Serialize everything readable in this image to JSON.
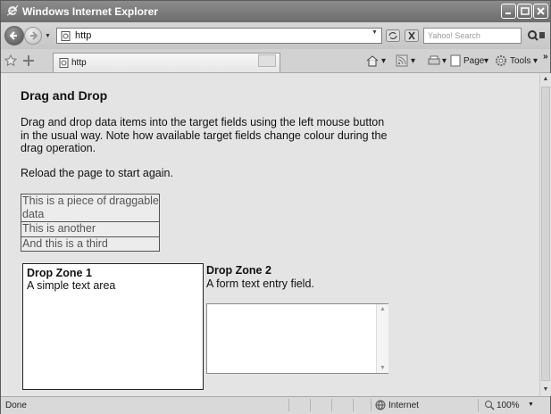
{
  "window": {
    "title": "Windows Internet Explorer"
  },
  "address_bar": {
    "url": "http",
    "search_placeholder": "Yahoo! Search"
  },
  "tab": {
    "label": "http"
  },
  "command_bar": {
    "page_label": "Page",
    "tools_label": "Tools",
    "more": "»"
  },
  "page": {
    "heading": "Drag and Drop",
    "intro": "Drag and drop data items into the target fields using the left mouse button in the usual way. Note how available target fields change colour during the drag operation.",
    "reload": "Reload the page to start again.",
    "drag_items": [
      "This is a piece of draggable data",
      "This is another",
      "And this is a third"
    ],
    "drop_zone_1": {
      "title": "Drop Zone 1",
      "description": "A simple text area"
    },
    "drop_zone_2": {
      "title": "Drop Zone 2",
      "description": "A form text entry field.",
      "value": ""
    }
  },
  "status_bar": {
    "status": "Done",
    "zone": "Internet",
    "zoom": "100%"
  }
}
